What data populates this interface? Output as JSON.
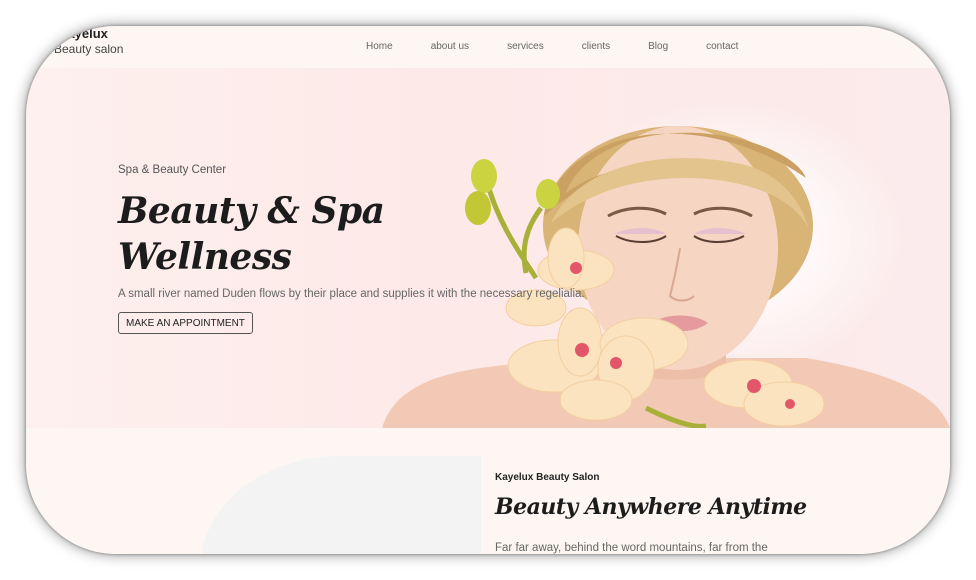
{
  "brand": {
    "name": "Kayelux",
    "subtitle": "Beauty salon"
  },
  "nav": {
    "items": [
      "Home",
      "about us",
      "services",
      "clients",
      "Blog",
      "contact"
    ]
  },
  "hero": {
    "eyebrow": "Spa & Beauty Center",
    "title": "Beauty & Spa Wellness",
    "description": "A small river named Duden flows by their place and supplies it with the necessary regelialia.",
    "cta_label": "MAKE AN APPOINTMENT"
  },
  "about": {
    "eyebrow": "Kayelux Beauty Salon",
    "title": "Beauty Anywhere Anytime",
    "text": "Far far away, behind the word mountains, far from the"
  },
  "colors": {
    "background": "#fdf6f2",
    "hero_bg": "#fde9e8",
    "text_dark": "#1c1c1c"
  },
  "icons": [
    "portrait-image",
    "orchid-image"
  ]
}
